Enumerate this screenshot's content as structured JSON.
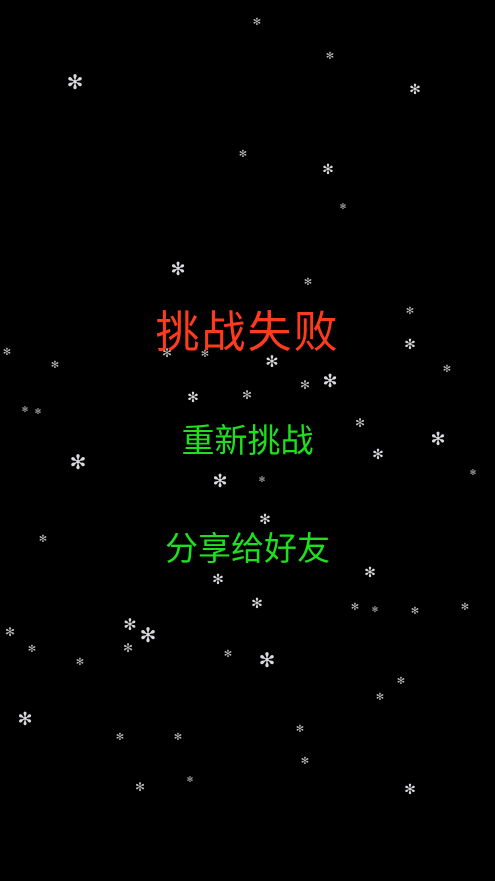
{
  "screen": {
    "title": "挑战失败",
    "title_color": "#ff3b1f",
    "buttons": {
      "retry_label": "重新挑战",
      "share_label": "分享给好友"
    },
    "button_color": "#1fe01f",
    "background_color": "#000000",
    "decoration_icon": "snowflake-icon"
  }
}
